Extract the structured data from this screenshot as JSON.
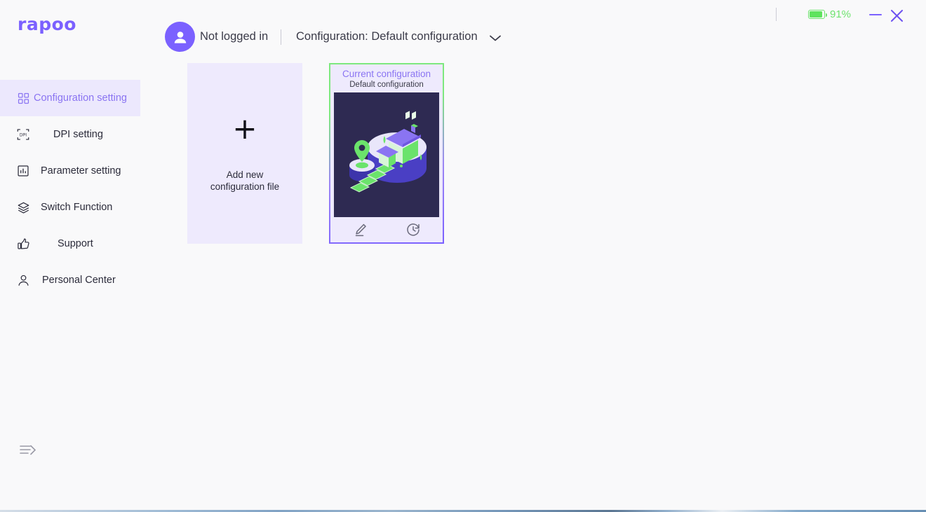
{
  "app": {
    "logo": "rapoo"
  },
  "header": {
    "account_status": "Not logged in",
    "configuration_label": "Configuration: Default configuration",
    "avatar_icon": "user-avatar-icon",
    "chevron_icon": "chevron-down-icon"
  },
  "window": {
    "battery_percent": "91%",
    "battery_level": 91,
    "battery_color": "#6ee36e",
    "minimize_label": "—",
    "close_label": "✕"
  },
  "sidebar": {
    "items": [
      {
        "label": "Configuration setting",
        "icon": "grid-icon",
        "active": true
      },
      {
        "label": "DPI setting",
        "icon": "dpi-icon",
        "active": false
      },
      {
        "label": "Parameter setting",
        "icon": "bar-chart-icon",
        "active": false
      },
      {
        "label": "Switch Function",
        "icon": "layers-icon",
        "active": false
      },
      {
        "label": "Support",
        "icon": "thumbs-up-icon",
        "active": false
      },
      {
        "label": "Personal Center",
        "icon": "person-icon",
        "active": false
      }
    ],
    "collapse_icon": "collapse-sidebar-icon",
    "active_color": "#8a74f2",
    "active_bg": "#ece8fd"
  },
  "main": {
    "add_card": {
      "plus": "+",
      "line1": "Add new",
      "line2": "configuration file"
    },
    "current_card": {
      "title": "Current configuration",
      "subtitle": "Default configuration",
      "title_color": "#8a74f2",
      "border_accent": "#7ee87e",
      "edit_icon": "pencil-edit-icon",
      "restore_icon": "history-restore-icon",
      "illustration": "isometric-house-location-illustration"
    }
  },
  "scrollbar": {
    "color": "#7b61ff"
  }
}
